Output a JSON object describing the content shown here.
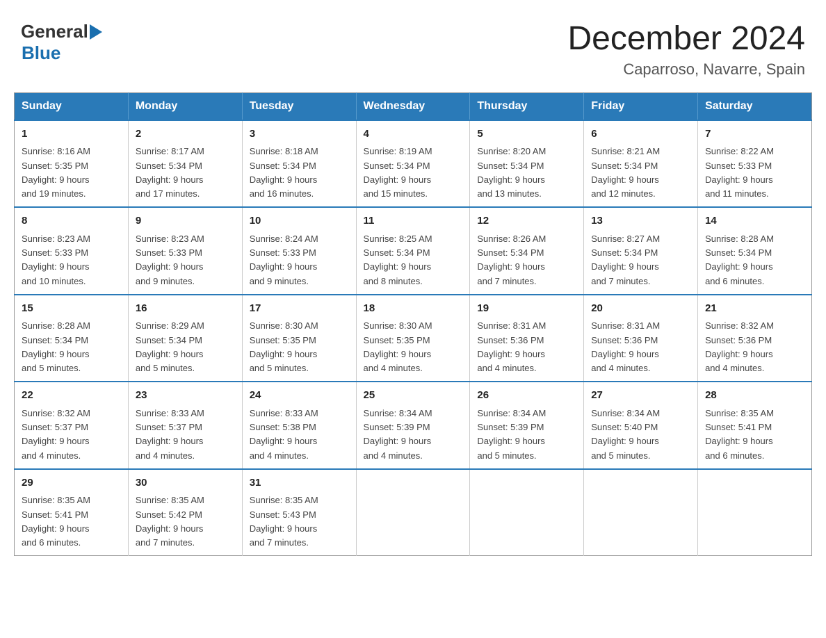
{
  "header": {
    "logo": {
      "general_text": "General",
      "blue_text": "Blue"
    },
    "title": "December 2024",
    "subtitle": "Caparroso, Navarre, Spain"
  },
  "calendar": {
    "days_of_week": [
      "Sunday",
      "Monday",
      "Tuesday",
      "Wednesday",
      "Thursday",
      "Friday",
      "Saturday"
    ],
    "weeks": [
      [
        {
          "day": "1",
          "sunrise": "8:16 AM",
          "sunset": "5:35 PM",
          "daylight": "9 hours and 19 minutes."
        },
        {
          "day": "2",
          "sunrise": "8:17 AM",
          "sunset": "5:34 PM",
          "daylight": "9 hours and 17 minutes."
        },
        {
          "day": "3",
          "sunrise": "8:18 AM",
          "sunset": "5:34 PM",
          "daylight": "9 hours and 16 minutes."
        },
        {
          "day": "4",
          "sunrise": "8:19 AM",
          "sunset": "5:34 PM",
          "daylight": "9 hours and 15 minutes."
        },
        {
          "day": "5",
          "sunrise": "8:20 AM",
          "sunset": "5:34 PM",
          "daylight": "9 hours and 13 minutes."
        },
        {
          "day": "6",
          "sunrise": "8:21 AM",
          "sunset": "5:34 PM",
          "daylight": "9 hours and 12 minutes."
        },
        {
          "day": "7",
          "sunrise": "8:22 AM",
          "sunset": "5:33 PM",
          "daylight": "9 hours and 11 minutes."
        }
      ],
      [
        {
          "day": "8",
          "sunrise": "8:23 AM",
          "sunset": "5:33 PM",
          "daylight": "9 hours and 10 minutes."
        },
        {
          "day": "9",
          "sunrise": "8:23 AM",
          "sunset": "5:33 PM",
          "daylight": "9 hours and 9 minutes."
        },
        {
          "day": "10",
          "sunrise": "8:24 AM",
          "sunset": "5:33 PM",
          "daylight": "9 hours and 9 minutes."
        },
        {
          "day": "11",
          "sunrise": "8:25 AM",
          "sunset": "5:34 PM",
          "daylight": "9 hours and 8 minutes."
        },
        {
          "day": "12",
          "sunrise": "8:26 AM",
          "sunset": "5:34 PM",
          "daylight": "9 hours and 7 minutes."
        },
        {
          "day": "13",
          "sunrise": "8:27 AM",
          "sunset": "5:34 PM",
          "daylight": "9 hours and 7 minutes."
        },
        {
          "day": "14",
          "sunrise": "8:28 AM",
          "sunset": "5:34 PM",
          "daylight": "9 hours and 6 minutes."
        }
      ],
      [
        {
          "day": "15",
          "sunrise": "8:28 AM",
          "sunset": "5:34 PM",
          "daylight": "9 hours and 5 minutes."
        },
        {
          "day": "16",
          "sunrise": "8:29 AM",
          "sunset": "5:34 PM",
          "daylight": "9 hours and 5 minutes."
        },
        {
          "day": "17",
          "sunrise": "8:30 AM",
          "sunset": "5:35 PM",
          "daylight": "9 hours and 5 minutes."
        },
        {
          "day": "18",
          "sunrise": "8:30 AM",
          "sunset": "5:35 PM",
          "daylight": "9 hours and 4 minutes."
        },
        {
          "day": "19",
          "sunrise": "8:31 AM",
          "sunset": "5:36 PM",
          "daylight": "9 hours and 4 minutes."
        },
        {
          "day": "20",
          "sunrise": "8:31 AM",
          "sunset": "5:36 PM",
          "daylight": "9 hours and 4 minutes."
        },
        {
          "day": "21",
          "sunrise": "8:32 AM",
          "sunset": "5:36 PM",
          "daylight": "9 hours and 4 minutes."
        }
      ],
      [
        {
          "day": "22",
          "sunrise": "8:32 AM",
          "sunset": "5:37 PM",
          "daylight": "9 hours and 4 minutes."
        },
        {
          "day": "23",
          "sunrise": "8:33 AM",
          "sunset": "5:37 PM",
          "daylight": "9 hours and 4 minutes."
        },
        {
          "day": "24",
          "sunrise": "8:33 AM",
          "sunset": "5:38 PM",
          "daylight": "9 hours and 4 minutes."
        },
        {
          "day": "25",
          "sunrise": "8:34 AM",
          "sunset": "5:39 PM",
          "daylight": "9 hours and 4 minutes."
        },
        {
          "day": "26",
          "sunrise": "8:34 AM",
          "sunset": "5:39 PM",
          "daylight": "9 hours and 5 minutes."
        },
        {
          "day": "27",
          "sunrise": "8:34 AM",
          "sunset": "5:40 PM",
          "daylight": "9 hours and 5 minutes."
        },
        {
          "day": "28",
          "sunrise": "8:35 AM",
          "sunset": "5:41 PM",
          "daylight": "9 hours and 6 minutes."
        }
      ],
      [
        {
          "day": "29",
          "sunrise": "8:35 AM",
          "sunset": "5:41 PM",
          "daylight": "9 hours and 6 minutes."
        },
        {
          "day": "30",
          "sunrise": "8:35 AM",
          "sunset": "5:42 PM",
          "daylight": "9 hours and 7 minutes."
        },
        {
          "day": "31",
          "sunrise": "8:35 AM",
          "sunset": "5:43 PM",
          "daylight": "9 hours and 7 minutes."
        },
        null,
        null,
        null,
        null
      ]
    ]
  }
}
